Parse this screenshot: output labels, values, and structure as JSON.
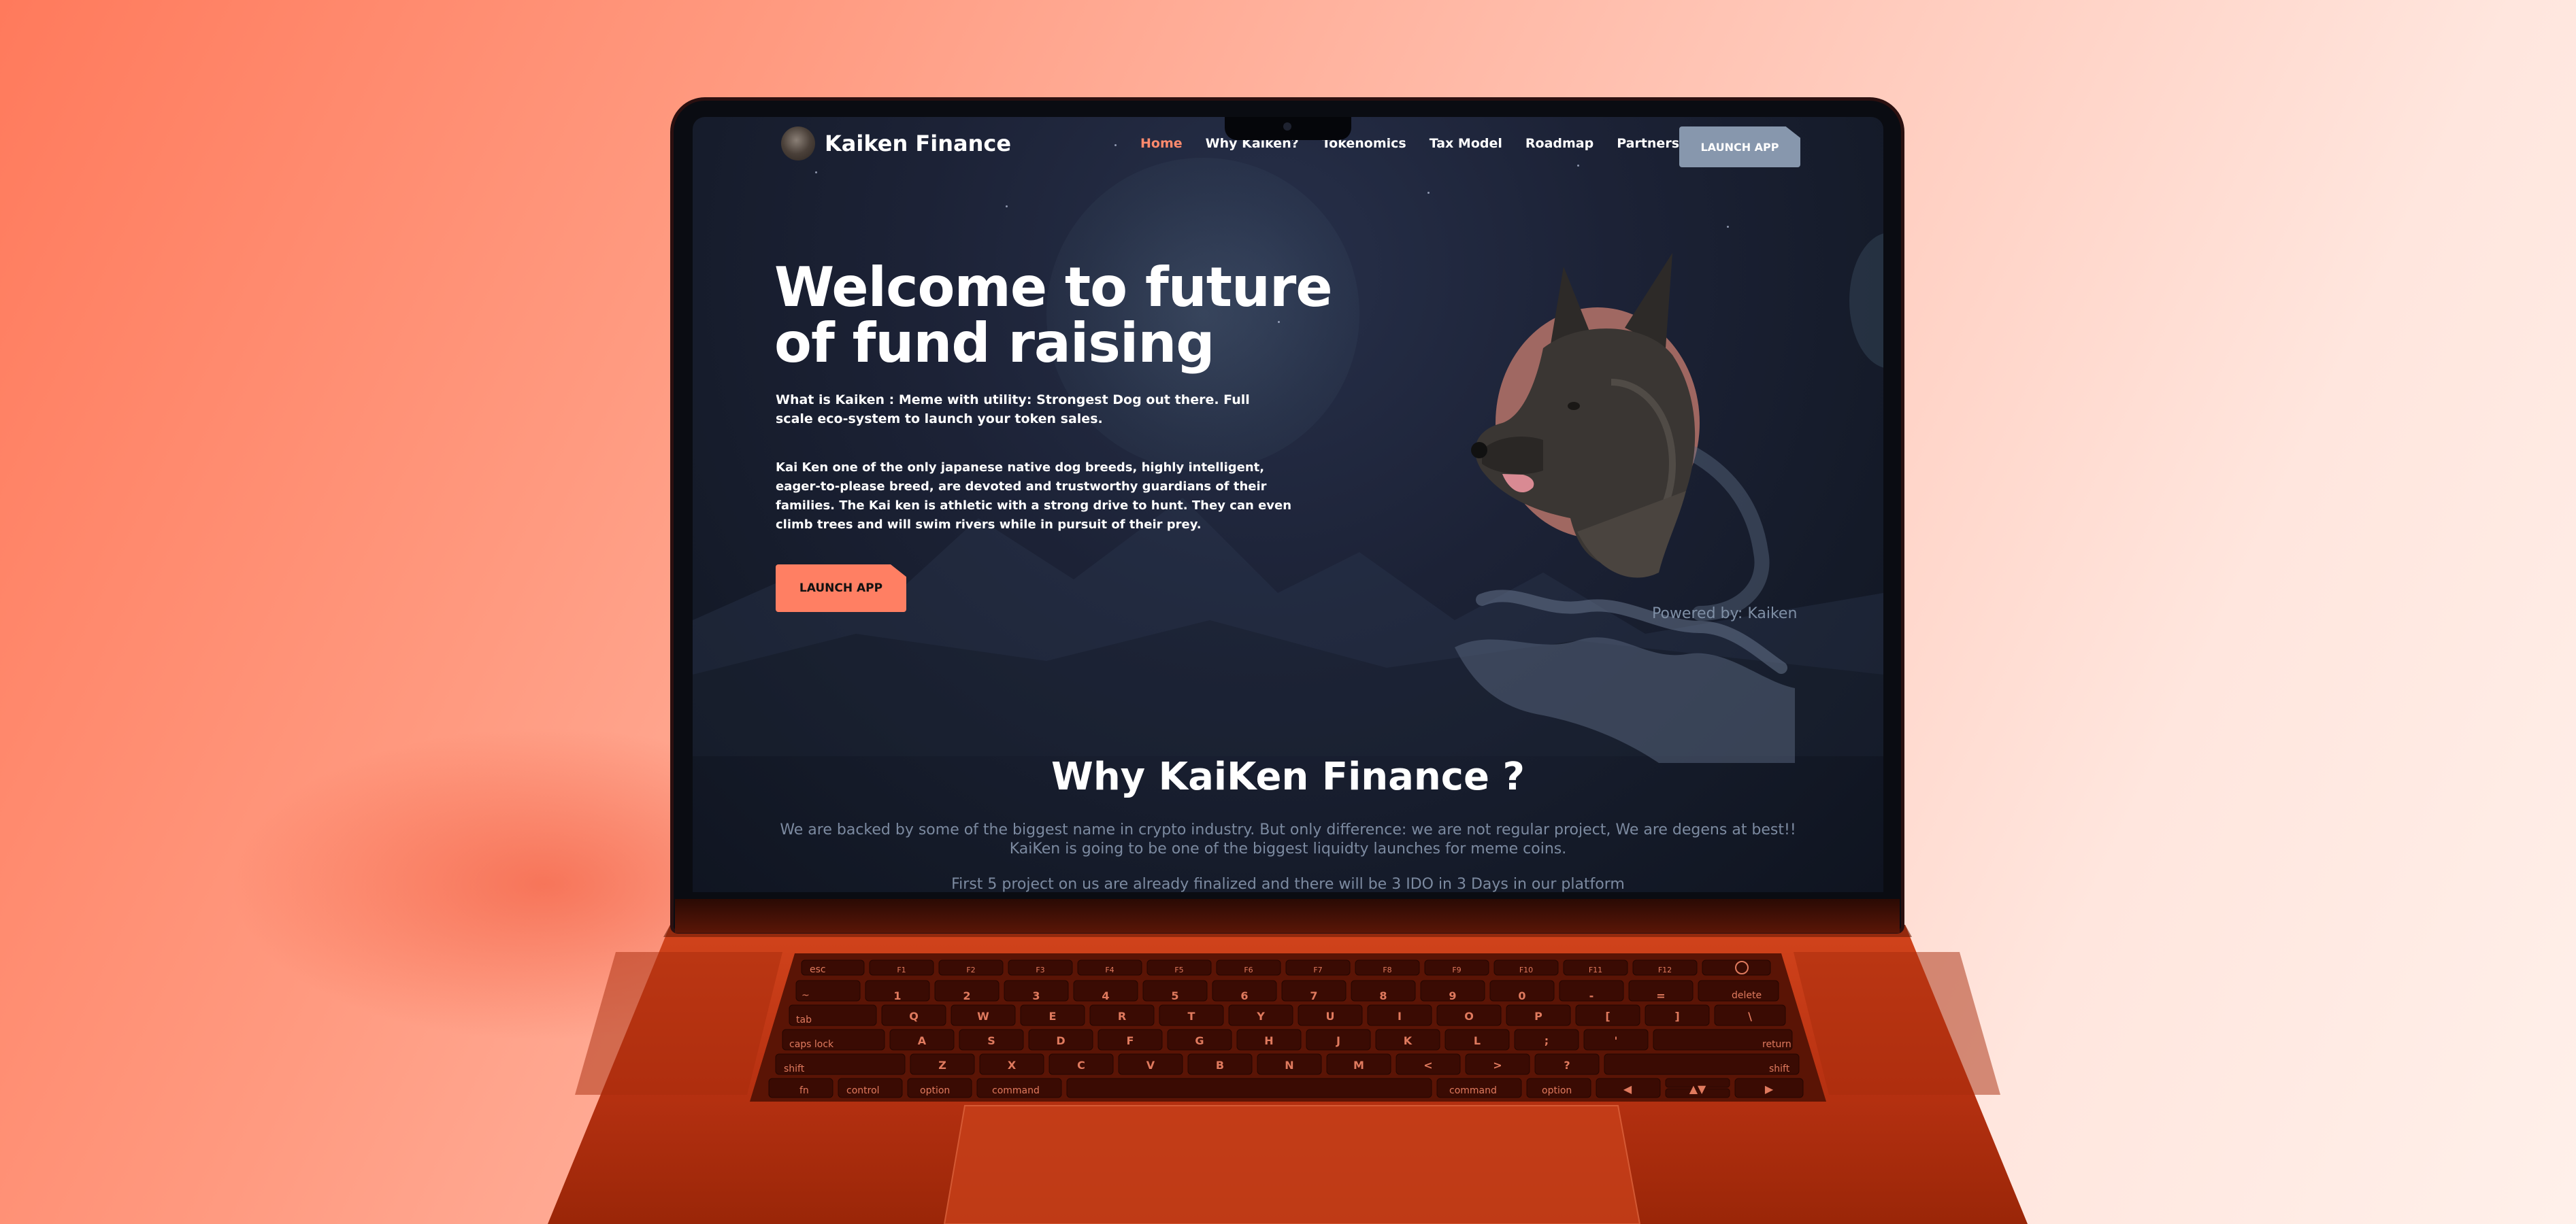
{
  "site": {
    "brand": "Kaiken Finance",
    "nav": [
      "Home",
      "Why Kaiken?",
      "Tokenomics",
      "Tax Model",
      "Roadmap",
      "Partners"
    ],
    "active_nav": "Home",
    "nav_cta": "LAUNCH APP"
  },
  "hero": {
    "title_line1": "Welcome to future",
    "title_line2": "of fund raising",
    "subtitle": "What is Kaiken : Meme with utility: Strongest Dog out there. Full scale eco-system to launch your token sales.",
    "description": "Kai Ken one of the only japanese native dog breeds, highly intelligent, eager-to-please breed, are devoted and trustworthy guardians of their families. The Kai ken is athletic with a strong drive to hunt. They can even climb trees and will swim rivers while in pursuit of their prey.",
    "cta": "LAUNCH APP",
    "powered_by": "Powered by: Kaiken"
  },
  "why": {
    "title": "Why KaiKen Finance ?",
    "line1": "We are backed by some of the biggest name in crypto industry. But only difference: we are not regular project, We are degens at best!!",
    "line2": "KaiKen is going to be one of the biggest liquidty launches for meme coins.",
    "line3": "First 5 project on us are already finalized and there will be 3 IDO in 3 Days in our platform"
  },
  "keyboard": {
    "row1": [
      "esc",
      "F1",
      "F2",
      "F3",
      "F4",
      "F5",
      "F6",
      "F7",
      "F8",
      "F9",
      "F10",
      "F11",
      "F12",
      ""
    ],
    "row2": [
      "~",
      "1",
      "2",
      "3",
      "4",
      "5",
      "6",
      "7",
      "8",
      "9",
      "0",
      "-",
      "=",
      "delete"
    ],
    "row3": [
      "tab",
      "Q",
      "W",
      "E",
      "R",
      "T",
      "Y",
      "U",
      "I",
      "O",
      "P",
      "[",
      "]",
      "\\"
    ],
    "row4": [
      "caps lock",
      "A",
      "S",
      "D",
      "F",
      "G",
      "H",
      "J",
      "K",
      "L",
      ";",
      "'",
      "return"
    ],
    "row5": [
      "shift",
      "Z",
      "X",
      "C",
      "V",
      "B",
      "N",
      "M",
      "<",
      ">",
      "?",
      "shift"
    ],
    "row6": [
      "fn",
      "control",
      "option",
      "command",
      "",
      "command",
      "option",
      "◀",
      "▲▼",
      "▶"
    ]
  },
  "colors": {
    "accent": "#ff7f63",
    "nav_active": "#ff8a6d",
    "nav_cta_bg": "#8797ad",
    "page_bg": "#1c2236",
    "laptop_body": "#b9310f"
  }
}
